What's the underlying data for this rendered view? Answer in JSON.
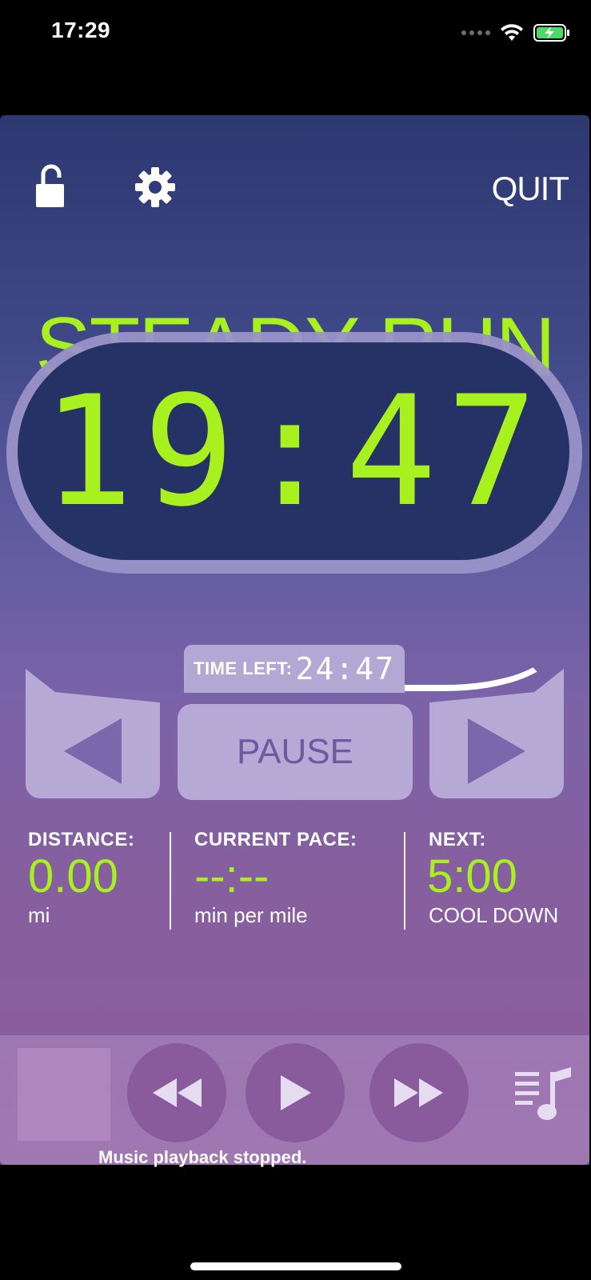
{
  "status_bar": {
    "time": "17:29"
  },
  "colors": {
    "accent_green": "#a8f01e",
    "bg_top": "#2c3870",
    "bg_bottom": "#8d5e9c",
    "display_bg": "#253265",
    "button_bg": "#b7a9d5"
  },
  "header": {
    "quit_label": "QUIT",
    "lock_icon": "unlock-icon",
    "settings_icon": "gear-icon"
  },
  "workout": {
    "segment_title": "STEADY RUN",
    "timer": "19:47",
    "time_left_label": "TIME LEFT:",
    "time_left_value": "24:47",
    "pause_label": "PAUSE"
  },
  "stats": {
    "distance": {
      "label": "DISTANCE:",
      "value": "0.00",
      "unit": "mi"
    },
    "pace": {
      "label": "CURRENT PACE:",
      "value": "--:--",
      "unit": "min per mile"
    },
    "next": {
      "label": "NEXT:",
      "value": "5:00",
      "unit": "COOL DOWN"
    }
  },
  "music": {
    "status": "Music playback stopped."
  }
}
